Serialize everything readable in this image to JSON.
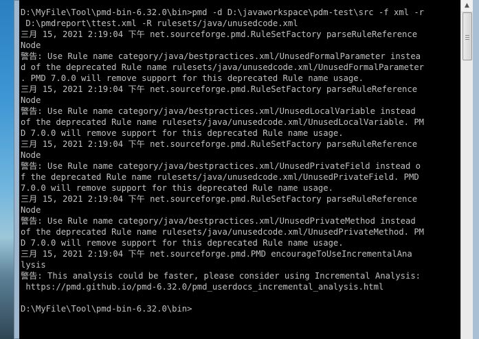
{
  "console": {
    "lines": [
      "D:\\MyFile\\Tool\\pmd-bin-6.32.0\\bin>pmd -d D:\\javaworkspace\\pdm-test\\src -f xml -r",
      " D:\\pmdreport\\ttest.xml -R rulesets/java/unusedcode.xml",
      "三月 15, 2021 2:19:04 下午 net.sourceforge.pmd.RuleSetFactory parseRuleReference",
      "Node",
      "警告: Use Rule name category/java/bestpractices.xml/UnusedFormalParameter instea",
      "d of the deprecated Rule name rulesets/java/unusedcode.xml/UnusedFormalParameter",
      ". PMD 7.0.0 will remove support for this deprecated Rule name usage.",
      "三月 15, 2021 2:19:04 下午 net.sourceforge.pmd.RuleSetFactory parseRuleReference",
      "Node",
      "警告: Use Rule name category/java/bestpractices.xml/UnusedLocalVariable instead",
      "of the deprecated Rule name rulesets/java/unusedcode.xml/UnusedLocalVariable. PM",
      "D 7.0.0 will remove support for this deprecated Rule name usage.",
      "三月 15, 2021 2:19:04 下午 net.sourceforge.pmd.RuleSetFactory parseRuleReference",
      "Node",
      "警告: Use Rule name category/java/bestpractices.xml/UnusedPrivateField instead o",
      "f the deprecated Rule name rulesets/java/unusedcode.xml/UnusedPrivateField. PMD",
      "7.0.0 will remove support for this deprecated Rule name usage.",
      "三月 15, 2021 2:19:04 下午 net.sourceforge.pmd.RuleSetFactory parseRuleReference",
      "Node",
      "警告: Use Rule name category/java/bestpractices.xml/UnusedPrivateMethod instead",
      "of the deprecated Rule name rulesets/java/unusedcode.xml/UnusedPrivateMethod. PM",
      "D 7.0.0 will remove support for this deprecated Rule name usage.",
      "三月 15, 2021 2:19:04 下午 net.sourceforge.pmd.PMD encourageToUseIncrementalAna",
      "lysis",
      "警告: This analysis could be faster, please consider using Incremental Analysis:",
      " https://pmd.github.io/pmd-6.32.0/pmd_userdocs_incremental_analysis.html",
      "",
      "D:\\MyFile\\Tool\\pmd-bin-6.32.0\\bin>"
    ],
    "text_color": "#c0c0c0",
    "background": "#000000"
  },
  "scrollbar": {
    "up_icon": "triangle-up-icon",
    "up_glyph": "▲",
    "position": 0
  }
}
